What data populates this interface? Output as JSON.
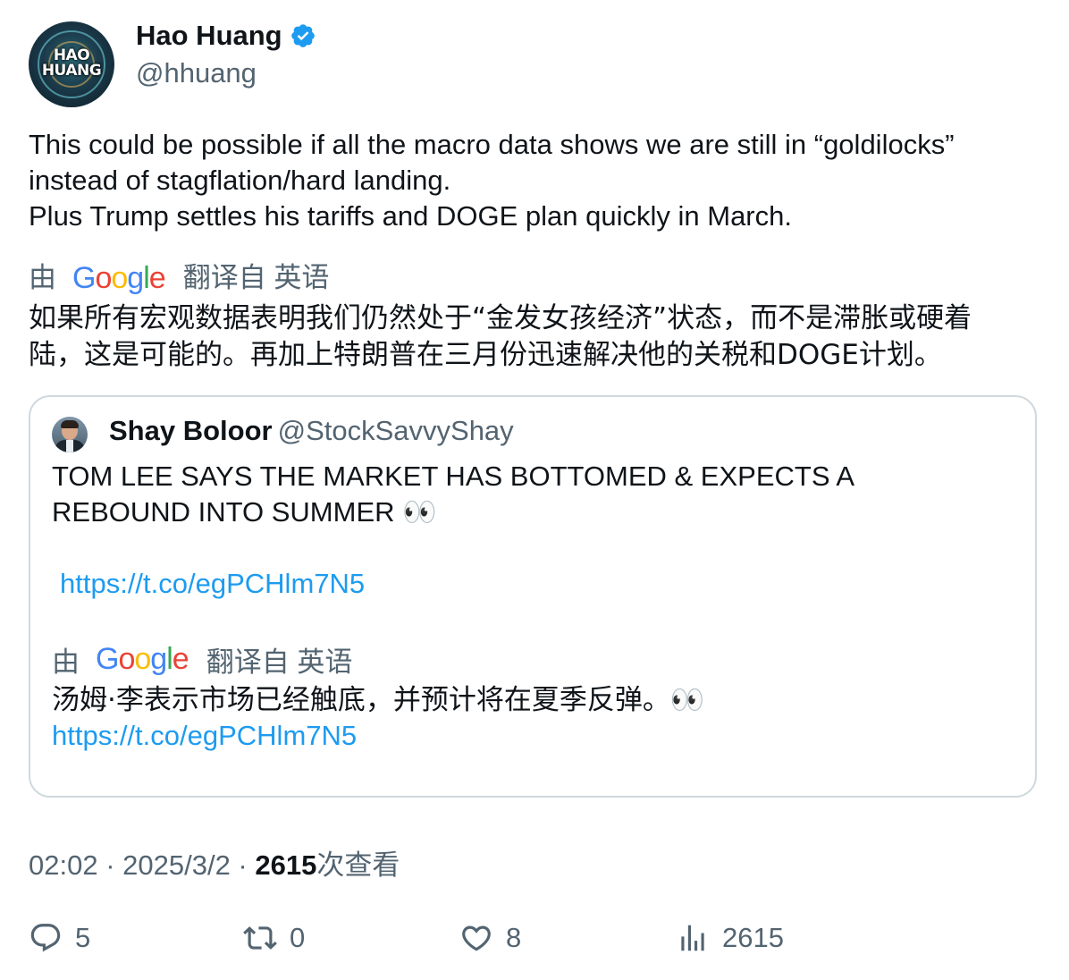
{
  "author": {
    "display_name": "Hao Huang",
    "handle": "@hhuang",
    "avatar_text_line1": "HAO",
    "avatar_text_line2": "HUANG",
    "verified_icon": "verified-badge-icon"
  },
  "tweet": {
    "lines": [
      "This could be possible if all the macro data shows we are still in “goldilocks”",
      "instead of stagflation/hard landing.",
      "Plus Trump settles his tariffs and DOGE plan quickly in March."
    ],
    "translate_by": "由",
    "translate_from": "翻译自 英语",
    "translated_lines": [
      "如果所有宏观数据表明我们仍然处于“金发女孩经济”状态，而不是滞胀或硬着",
      "陆，这是可能的。再加上特朗普在三月份迅速解决他的关税和DOGE计划。"
    ]
  },
  "quote": {
    "display_name": "Shay Boloor",
    "handle": "@StockSavvyShay",
    "lines": [
      "TOM LEE SAYS THE MARKET HAS BOTTOMED & EXPECTS A",
      "REBOUND INTO SUMMER   👀"
    ],
    "link": "https://t.co/egPCHlm7N5",
    "translate_by": "由",
    "translate_from": "翻译自 英语",
    "translated_line": "汤姆·李表示市场已经触底，并预计将在夏季反弹。👀",
    "translated_link": "https://t.co/egPCHlm7N5"
  },
  "meta": {
    "time": "02:02",
    "separator": " · ",
    "date": "2025/3/2",
    "views": "2615",
    "views_label": "次查看"
  },
  "actions": {
    "replies": "5",
    "reposts": "0",
    "likes": "8",
    "views": "2615"
  },
  "google_logo": [
    "G",
    "o",
    "o",
    "g",
    "l",
    "e"
  ],
  "colors": {
    "link": "#1d9bf0",
    "secondary_text": "#536471",
    "border": "#cfd9de",
    "verified": "#1d9bf0"
  }
}
